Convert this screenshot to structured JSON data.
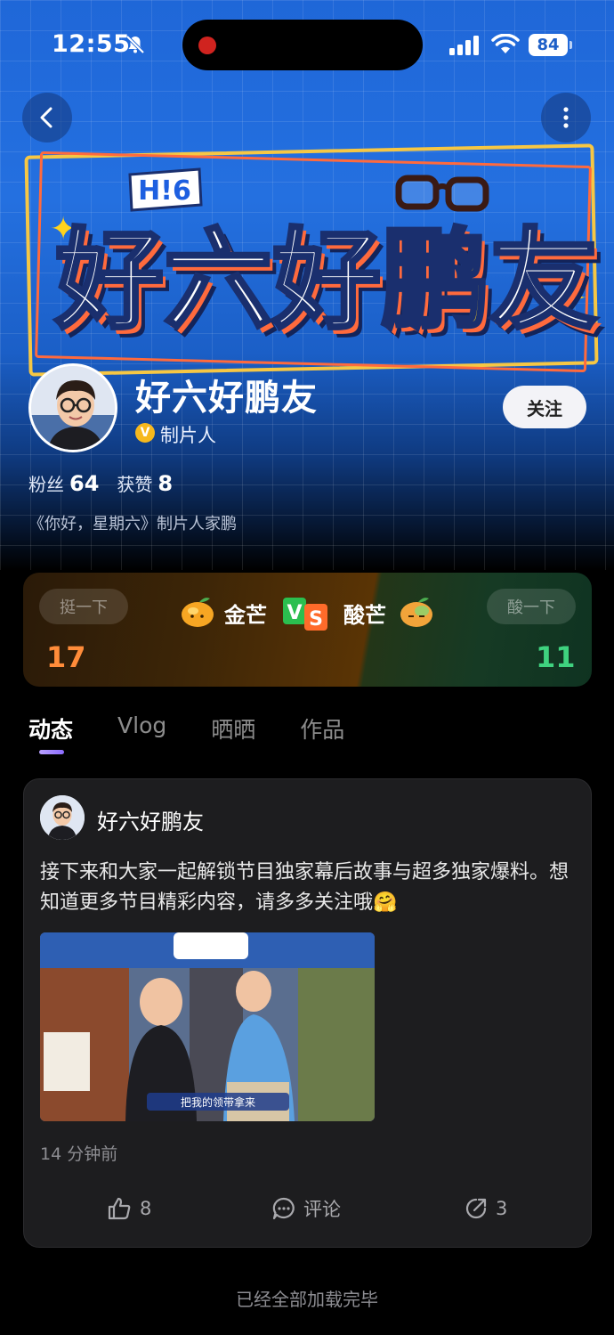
{
  "status_bar": {
    "time": "12:55",
    "battery": "84"
  },
  "nav": {
    "back_icon": "chevron-left-icon",
    "more_icon": "more-vertical-icon"
  },
  "banner": {
    "logo_text": "H!6",
    "art_chars": [
      "好",
      "六",
      "好",
      "鹏",
      "友"
    ],
    "art_colors": {
      "accent": "#ffd31d",
      "outline": "#ff6a3d",
      "frame": "#f6c744"
    }
  },
  "profile": {
    "name": "好六好鹏友",
    "verified_badge": "V",
    "role": "制片人",
    "follow_label": "关注",
    "fans_label": "粉丝",
    "fans_count": "64",
    "likes_label": "获赞",
    "likes_count": "8",
    "bio": "《你好，星期六》制片人家鹏"
  },
  "versus": {
    "left_button": "挺一下",
    "right_button": "酸一下",
    "left_team": "金芒",
    "right_team": "酸芒",
    "left_count": "17",
    "right_count": "11",
    "colors": {
      "left": "#ff8c3a",
      "right": "#3fd27f"
    }
  },
  "tabs": [
    {
      "label": "动态",
      "active": true
    },
    {
      "label": "Vlog",
      "active": false
    },
    {
      "label": "晒晒",
      "active": false
    },
    {
      "label": "作品",
      "active": false
    }
  ],
  "post": {
    "author": "好六好鹏友",
    "text": "接下来和大家一起解锁节目独家幕后故事与超多独家爆料。想知道更多节目精彩内容，请多多关注哦🤗",
    "image_caption": "把我的领带拿来",
    "time": "14 分钟前",
    "like_count": "8",
    "comment_label": "评论",
    "share_count": "3"
  },
  "footer": {
    "end_text": "已经全部加载完毕"
  }
}
